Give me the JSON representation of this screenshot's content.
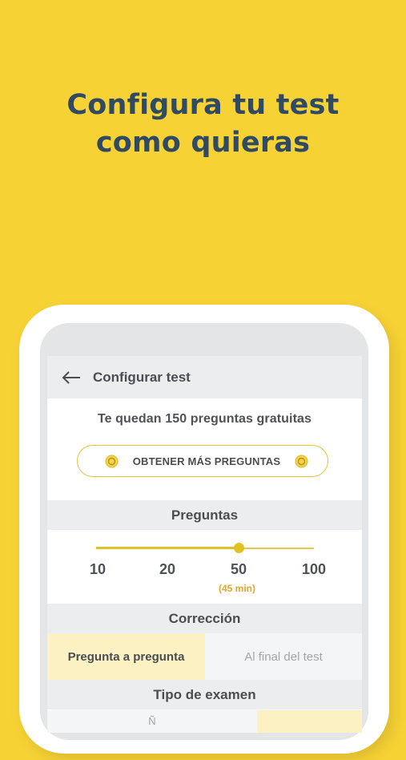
{
  "promo": {
    "headline_line1": "Configura tu test",
    "headline_line2": "como quieras"
  },
  "appbar": {
    "title": "Configurar test",
    "back_icon": "arrow-left-icon"
  },
  "quota": {
    "text": "Te quedan 150 preguntas gratuitas"
  },
  "more_button": {
    "label": "OBTENER MÁS PREGUNTAS",
    "icon": "coin-icon"
  },
  "questions": {
    "header": "Preguntas",
    "options": [
      "10",
      "20",
      "50",
      "100"
    ],
    "selected": "50",
    "selected_duration": "(45 min)"
  },
  "correction": {
    "header": "Corrección",
    "options": [
      "Pregunta a pregunta",
      "Al final del test"
    ],
    "selected": "Pregunta a pregunta"
  },
  "exam_type": {
    "header": "Tipo de examen",
    "partial_label": "Ñ"
  },
  "colors": {
    "background": "#F7D235",
    "headline": "#2F4A62",
    "accent": "#E2C123",
    "duration": "#E0A826",
    "selected_segment": "#FBF1C2"
  }
}
